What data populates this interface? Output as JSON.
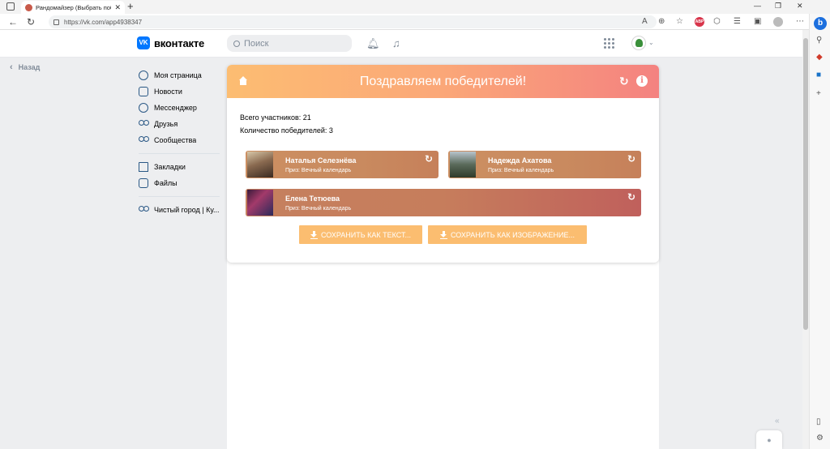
{
  "browser": {
    "tab_title": "Рандомайзер (Выбрать победит",
    "url": "https://vk.com/app4938347"
  },
  "vk": {
    "logo_text": "вконтакте",
    "logo_glyph": "VK",
    "search_placeholder": "Поиск",
    "back_label": "Назад",
    "nav": [
      {
        "label": "Моя страница",
        "icon": "user-circle-icon"
      },
      {
        "label": "Новости",
        "icon": "news-icon"
      },
      {
        "label": "Мессенджер",
        "icon": "chat-icon"
      },
      {
        "label": "Друзья",
        "icon": "friends-icon"
      },
      {
        "label": "Сообщества",
        "icon": "groups-icon"
      },
      {
        "label": "Закладки",
        "icon": "bookmark-icon"
      },
      {
        "label": "Файлы",
        "icon": "file-icon"
      },
      {
        "label": "Чистый город | Ку...",
        "icon": "groups-icon"
      }
    ]
  },
  "app": {
    "title": "Поздравляем победителей!",
    "total_participants": "Всего участников: 21",
    "winners_count": "Количество победителей: 3",
    "winners": [
      {
        "name": "Наталья Селезнёва",
        "prize": "Приз: Вечный календарь"
      },
      {
        "name": "Надежда Ахатова",
        "prize": "Приз: Вечный календарь"
      },
      {
        "name": "Елена Тетюева",
        "prize": "Приз: Вечный календарь"
      }
    ],
    "save_text_label": "СОХРАНИТЬ КАК ТЕКСТ...",
    "save_image_label": "СОХРАНИТЬ КАК ИЗОБРАЖЕНИЕ..."
  },
  "colors": {
    "vk_blue": "#0077ff",
    "header_gradient_start": "#fcbd72",
    "header_gradient_end": "#f48280",
    "button": "#fbbd70"
  }
}
